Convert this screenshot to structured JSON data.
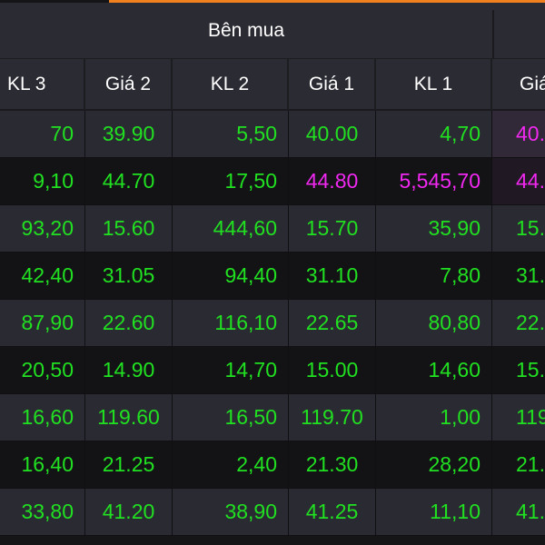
{
  "board": {
    "group_title": "Bên mua",
    "colors": {
      "accent": "#f0801e",
      "up": "#21e021",
      "ceiling": "#f028f0",
      "header_bg": "#2b2b33"
    },
    "columns": [
      "KL 3",
      "Giá 2",
      "KL 2",
      "Giá 1",
      "KL 1",
      "Giá"
    ],
    "rows": [
      {
        "kl3": "70",
        "gia2": "39.90",
        "kl2": "5,50",
        "gia1": "40.00",
        "kl1": "4,70",
        "gia_next": "40.",
        "gia1_color": "up",
        "kl1_color": "up",
        "next_color": "ceiling"
      },
      {
        "kl3": "9,10",
        "gia2": "44.70",
        "kl2": "17,50",
        "gia1": "44.80",
        "kl1": "5,545,70",
        "gia_next": "44.",
        "gia1_color": "ceiling",
        "kl1_color": "ceiling",
        "next_color": "ceiling"
      },
      {
        "kl3": "93,20",
        "gia2": "15.60",
        "kl2": "444,60",
        "gia1": "15.70",
        "kl1": "35,90",
        "gia_next": "15.",
        "gia1_color": "up",
        "kl1_color": "up",
        "next_color": "up"
      },
      {
        "kl3": "42,40",
        "gia2": "31.05",
        "kl2": "94,40",
        "gia1": "31.10",
        "kl1": "7,80",
        "gia_next": "31.",
        "gia1_color": "up",
        "kl1_color": "up",
        "next_color": "up"
      },
      {
        "kl3": "87,90",
        "gia2": "22.60",
        "kl2": "116,10",
        "gia1": "22.65",
        "kl1": "80,80",
        "gia_next": "22.",
        "gia1_color": "up",
        "kl1_color": "up",
        "next_color": "up"
      },
      {
        "kl3": "20,50",
        "gia2": "14.90",
        "kl2": "14,70",
        "gia1": "15.00",
        "kl1": "14,60",
        "gia_next": "15.",
        "gia1_color": "up",
        "kl1_color": "up",
        "next_color": "up"
      },
      {
        "kl3": "16,60",
        "gia2": "119.60",
        "kl2": "16,50",
        "gia1": "119.70",
        "kl1": "1,00",
        "gia_next": "119.",
        "gia1_color": "up",
        "kl1_color": "up",
        "next_color": "up"
      },
      {
        "kl3": "16,40",
        "gia2": "21.25",
        "kl2": "2,40",
        "gia1": "21.30",
        "kl1": "28,20",
        "gia_next": "21.",
        "gia1_color": "up",
        "kl1_color": "up",
        "next_color": "up"
      },
      {
        "kl3": "33,80",
        "gia2": "41.20",
        "kl2": "38,90",
        "gia1": "41.25",
        "kl1": "11,10",
        "gia_next": "41.",
        "gia1_color": "up",
        "kl1_color": "up",
        "next_color": "up"
      }
    ]
  }
}
